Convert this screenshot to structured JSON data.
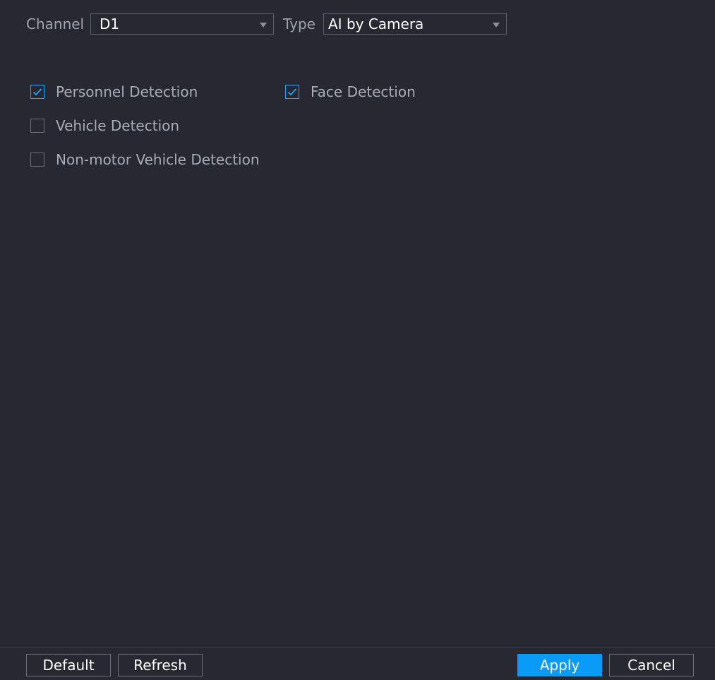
{
  "filters": {
    "channel_label": "Channel",
    "channel_value": "D1",
    "type_label": "Type",
    "type_value": "AI by Camera"
  },
  "detections": [
    {
      "label": "Personnel Detection",
      "checked": true
    },
    {
      "label": "Face Detection",
      "checked": true
    },
    {
      "label": "Vehicle Detection",
      "checked": false
    },
    {
      "label": "Non-motor Vehicle Detection",
      "checked": false
    }
  ],
  "footer": {
    "default_label": "Default",
    "refresh_label": "Refresh",
    "apply_label": "Apply",
    "cancel_label": "Cancel"
  },
  "colors": {
    "background": "#282832",
    "accent": "#0a9af7",
    "checkbox_checked": "#1aa3ff"
  },
  "icons": {
    "dropdown": "chevron-down-icon",
    "checked": "checkmark-icon"
  }
}
